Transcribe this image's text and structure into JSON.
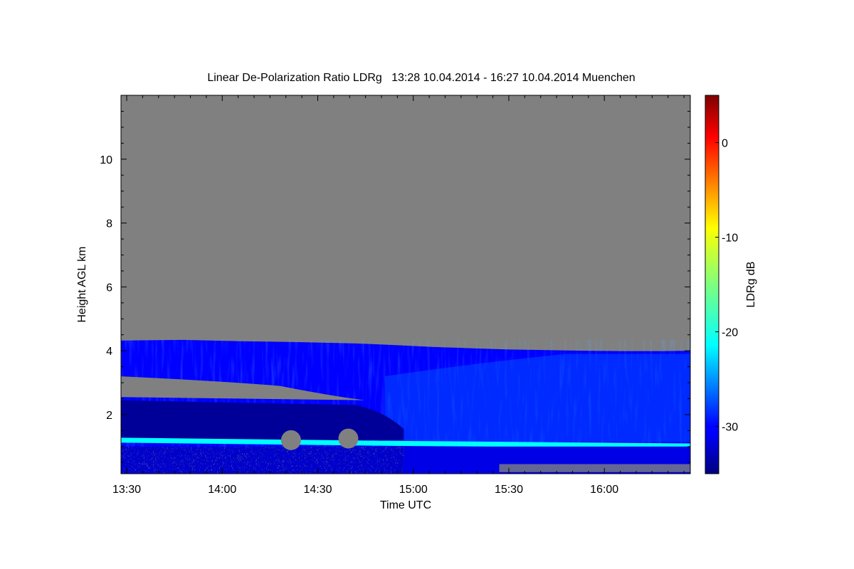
{
  "chart_data": {
    "type": "heatmap",
    "title": "Linear De-Polarization Ratio LDRg   13:28 10.04.2014 - 16:27 10.04.2014 Muenchen",
    "xlabel": "Time UTC",
    "ylabel": "Height AGL km",
    "colorbar_label": "LDRg dB",
    "x_ticks": [
      {
        "value": 13.5,
        "label": "13:30"
      },
      {
        "value": 14.0,
        "label": "14:00"
      },
      {
        "value": 14.5,
        "label": "14:30"
      },
      {
        "value": 15.0,
        "label": "15:00"
      },
      {
        "value": 15.5,
        "label": "15:30"
      },
      {
        "value": 16.0,
        "label": "16:00"
      }
    ],
    "y_ticks": [
      {
        "value": 2,
        "label": "2"
      },
      {
        "value": 4,
        "label": "4"
      },
      {
        "value": 6,
        "label": "6"
      },
      {
        "value": 8,
        "label": "8"
      },
      {
        "value": 10,
        "label": "10"
      }
    ],
    "colorbar_ticks": [
      {
        "value": 0,
        "label": "0"
      },
      {
        "value": -10,
        "label": "-10"
      },
      {
        "value": -20,
        "label": "-20"
      },
      {
        "value": -30,
        "label": "-30"
      }
    ],
    "xlim": [
      13.47,
      16.45
    ],
    "ylim": [
      0.15,
      12.0
    ],
    "clim": [
      -35,
      5
    ],
    "colormap": "jet",
    "no_signal_color": "#808080",
    "layers": [
      {
        "name": "noise (no signal)",
        "height_top": [
          4.32,
          4.34,
          4.3,
          4.27,
          4.23,
          4.18,
          4.12,
          4.08,
          4.04,
          4.02,
          4.0,
          3.99,
          3.99,
          4.0
        ],
        "time": [
          13.47,
          13.8,
          14.1,
          14.4,
          14.7,
          14.9,
          15.1,
          15.3,
          15.5,
          15.7,
          15.9,
          16.1,
          16.3,
          16.45
        ]
      },
      {
        "name": "aerosol layer",
        "ldr_db": -30,
        "height_range": [
          1.1,
          4.3
        ]
      },
      {
        "name": "elevated layer",
        "ldr_db": -26,
        "height_range": [
          1.1,
          2.4
        ]
      },
      {
        "name": "boundary layer top",
        "ldr_db": -20,
        "height": 1.05
      },
      {
        "name": "surface layer",
        "ldr_db_range": [
          -25,
          -5
        ],
        "height_range": [
          0.15,
          1.0
        ]
      }
    ]
  }
}
